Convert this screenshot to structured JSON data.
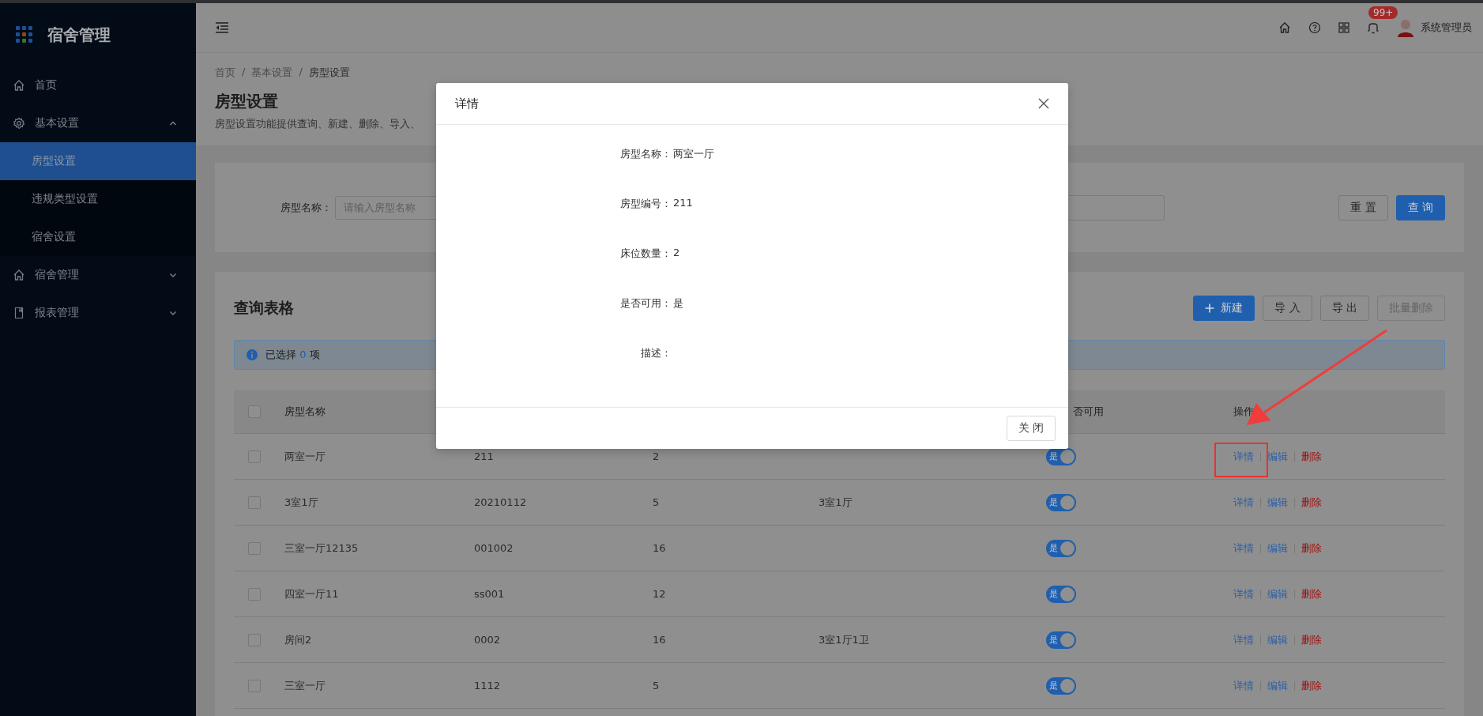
{
  "app_title": "宿舍管理",
  "sidebar": {
    "items": [
      {
        "label": "首页",
        "selected": false
      },
      {
        "label": "基本设置",
        "selected": false,
        "expanded": true,
        "children": [
          {
            "label": "房型设置",
            "selected": true
          },
          {
            "label": "违规类型设置",
            "selected": false
          },
          {
            "label": "宿舍设置",
            "selected": false
          }
        ]
      },
      {
        "label": "宿舍管理",
        "selected": false,
        "expanded": false
      },
      {
        "label": "报表管理",
        "selected": false,
        "expanded": false
      }
    ]
  },
  "header": {
    "notification_badge": "99+",
    "user_name": "系统管理员"
  },
  "breadcrumb": {
    "separator": "/",
    "items": [
      "首页",
      "基本设置",
      "房型设置"
    ]
  },
  "page": {
    "title": "房型设置",
    "description": "房型设置功能提供查询、新建、删除、导入、"
  },
  "search": {
    "label": "房型名称：",
    "placeholder": "请输入房型名称",
    "buttons": [
      {
        "label": "重 置",
        "primary": false
      },
      {
        "label": "查 询",
        "primary": true
      }
    ]
  },
  "table_card": {
    "title": "查询表格",
    "buttons": [
      {
        "label": "新建",
        "primary": true,
        "disabled": false
      },
      {
        "label": "导 入",
        "primary": false,
        "disabled": false
      },
      {
        "label": "导 出",
        "primary": false,
        "disabled": false
      },
      {
        "label": "批量删除",
        "primary": false,
        "disabled": true
      }
    ],
    "alert": {
      "prefix": "已选择",
      "count": "0",
      "suffix": "项"
    }
  },
  "table": {
    "header": {
      "checked": false,
      "name": "房型名称",
      "enabled": "否可用",
      "actions": "操作"
    },
    "rows": [
      {
        "checked": false,
        "name": "两室一厅",
        "code": "211",
        "beds": "2",
        "enabled": true,
        "enabled_label": "是",
        "actions": [
          "详情",
          "编辑",
          "删除"
        ]
      },
      {
        "checked": false,
        "name": "3室1厅",
        "code": "20210112",
        "beds": "5",
        "description": "3室1厅",
        "enabled": true,
        "enabled_label": "是",
        "actions": [
          "详情",
          "编辑",
          "删除"
        ]
      },
      {
        "checked": false,
        "name": "三室一厅12135",
        "code": "001002",
        "beds": "16",
        "enabled": true,
        "enabled_label": "是",
        "actions": [
          "详情",
          "编辑",
          "删除"
        ]
      },
      {
        "checked": false,
        "name": "四室一厅11",
        "code": "ss001",
        "beds": "12",
        "enabled": true,
        "enabled_label": "是",
        "actions": [
          "详情",
          "编辑",
          "删除"
        ]
      },
      {
        "checked": false,
        "name": "房间2",
        "code": "0002",
        "beds": "16",
        "description": "3室1厅1卫",
        "enabled": true,
        "enabled_label": "是",
        "actions": [
          "详情",
          "编辑",
          "删除"
        ]
      },
      {
        "checked": false,
        "name": "三室一厅",
        "code": "1112",
        "beds": "5",
        "enabled": true,
        "enabled_label": "是",
        "actions": [
          "详情",
          "编辑",
          "删除"
        ]
      }
    ]
  },
  "modal": {
    "title": "详情",
    "fields": [
      {
        "label": "房型名称：",
        "value": "两室一厅"
      },
      {
        "label": "房型编号：",
        "value": "211"
      },
      {
        "label": "床位数量：",
        "value": "2"
      },
      {
        "label": "是否可用：",
        "value": "是"
      },
      {
        "label": "描述："
      }
    ],
    "close_button": "关 闭"
  }
}
